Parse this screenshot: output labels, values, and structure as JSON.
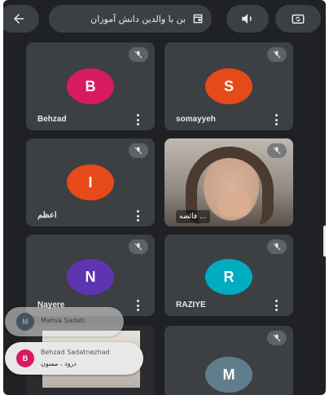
{
  "topbar": {
    "title": "بن با والدین دانش آموزان",
    "back_icon": "arrow-left-icon",
    "audio_icon": "speaker-icon",
    "camera_icon": "switch-camera-icon"
  },
  "tiles": [
    {
      "initial": "B",
      "name": "Behzad",
      "color": "#d81b60"
    },
    {
      "initial": "S",
      "name": "somayyeh",
      "color": "#e64a19"
    },
    {
      "initial": "I",
      "name": "اعظم",
      "color": "#e64a19"
    },
    {
      "video_label": "... فائضه"
    },
    {
      "initial": "N",
      "name": "Nayere",
      "color": "#5e35b1"
    },
    {
      "initial": "R",
      "name": "RAZIYE",
      "color": "#00acc1"
    },
    {
      "initial": "M",
      "color": "#607d8b"
    }
  ],
  "toasts": [
    {
      "initial": "M",
      "name": "Mahsa Sadati",
      "color": "#607d8b"
    },
    {
      "initial": "B",
      "name": "Behzad Sadatnezhad",
      "message": "درود ، ممنون",
      "color": "#d81b60"
    }
  ]
}
